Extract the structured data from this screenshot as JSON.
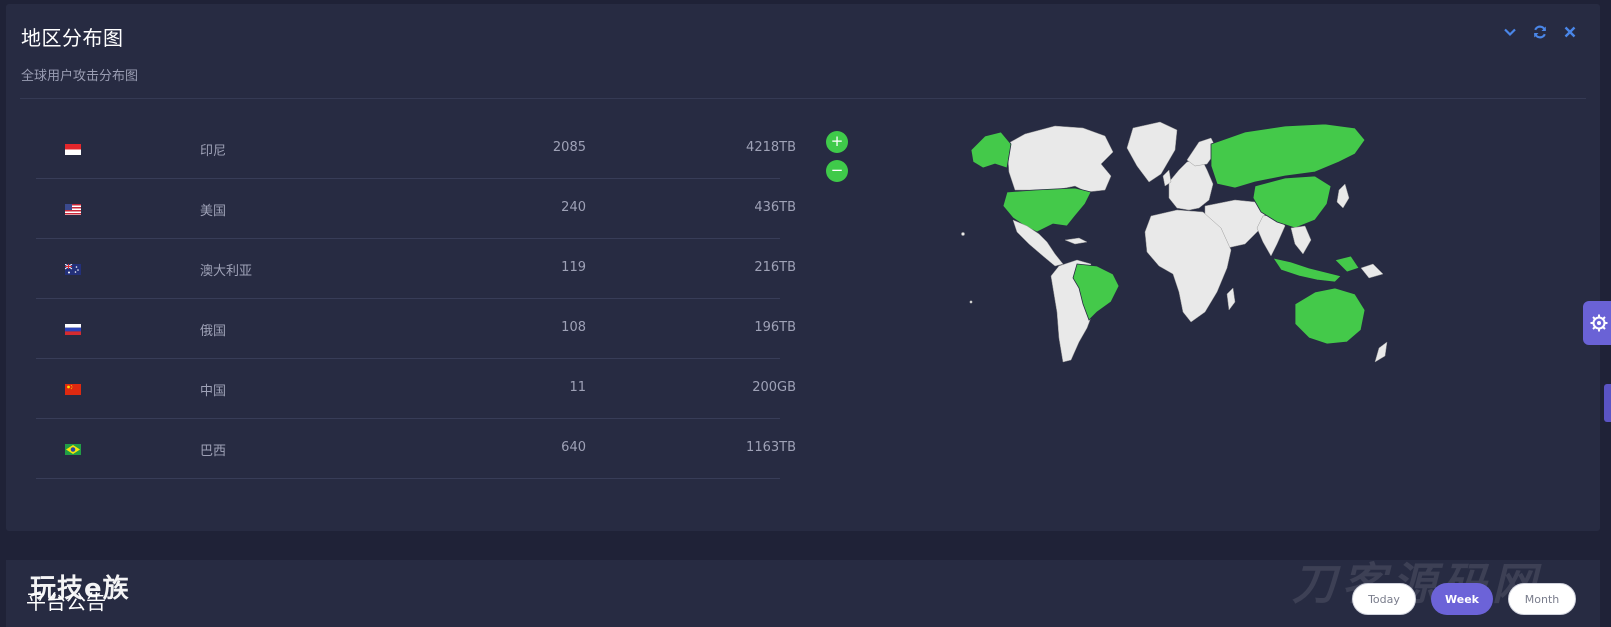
{
  "panel": {
    "title": "地区分布图",
    "subtitle": "全球用户攻击分布图"
  },
  "tools": [
    {
      "icon": "chevron-down-icon"
    },
    {
      "icon": "refresh-icon"
    },
    {
      "icon": "close-icon"
    }
  ],
  "table": {
    "rows": [
      {
        "flag": "indonesia-flag-icon",
        "country": "印尼",
        "count": "2085",
        "traffic": "4218TB"
      },
      {
        "flag": "usa-flag-icon",
        "country": "美国",
        "count": "240",
        "traffic": "436TB"
      },
      {
        "flag": "australia-flag-icon",
        "country": "澳大利亚",
        "count": "119",
        "traffic": "216TB"
      },
      {
        "flag": "russia-flag-icon",
        "country": "俄国",
        "count": "108",
        "traffic": "196TB"
      },
      {
        "flag": "china-flag-icon",
        "country": "中国",
        "count": "11",
        "traffic": "200GB"
      },
      {
        "flag": "brazil-flag-icon",
        "country": "巴西",
        "count": "640",
        "traffic": "1163TB"
      }
    ]
  },
  "map": {
    "zoom_in": "+",
    "zoom_out": "−",
    "highlight_color": "#44c94a",
    "base_color": "#e9e9e9",
    "highlighted_countries": [
      "印尼",
      "美国",
      "澳大利亚",
      "俄国",
      "中国",
      "巴西"
    ]
  },
  "panel2": {
    "title": "平台公告",
    "logo": "玩技e族",
    "watermark": "刀客源码网",
    "ranges": [
      {
        "label": "Today",
        "active": false
      },
      {
        "label": "Week",
        "active": true
      },
      {
        "label": "Month",
        "active": false
      }
    ]
  },
  "colors": {
    "background": "#1f2237",
    "panel": "#272b42",
    "accent": "#6c63d8",
    "tool_icon": "#4a86e8"
  }
}
